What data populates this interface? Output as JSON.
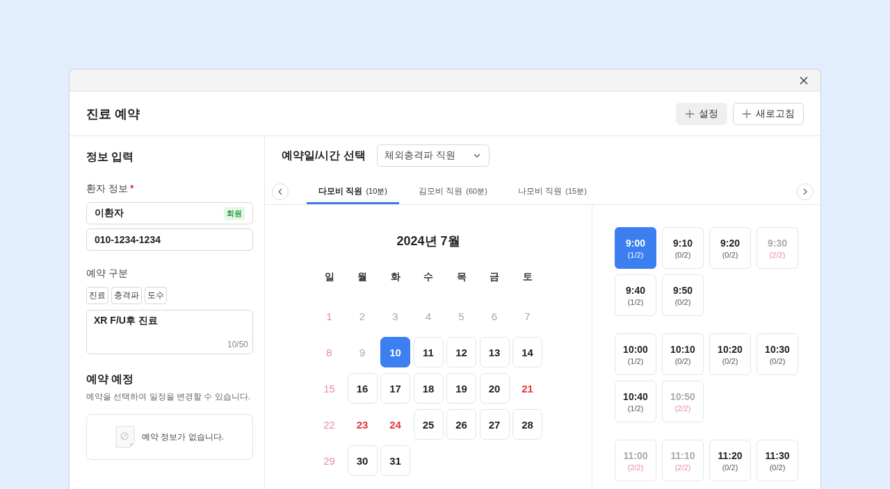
{
  "window": {
    "title": "진료 예약"
  },
  "header_buttons": [
    {
      "label": "설정",
      "kind": "filled"
    },
    {
      "label": "새로고침",
      "kind": "outline"
    }
  ],
  "info": {
    "title": "정보 입력",
    "patient_label": "환자 정보",
    "required_mark": "*",
    "patient_name": "이환자",
    "member_badge": "회원",
    "phone": "010-1234-1234",
    "type_label": "예약 구분",
    "type_tags": [
      "진료",
      "충격파",
      "도수"
    ],
    "memo": "XR F/U후 진료",
    "memo_count": "10/50"
  },
  "schedule": {
    "title": "예약 예정",
    "hint": "예약을 선택하여 일정을 변경할 수 있습니다.",
    "empty_text": "예약 정보가 없습니다."
  },
  "picker": {
    "title": "예약일/시간 선택",
    "dropdown_value": "체외충격파 직원"
  },
  "staff_tabs": [
    {
      "name": "다모비 직원",
      "duration": "(10분)",
      "selected": true
    },
    {
      "name": "김모비 직원",
      "duration": "(60분)",
      "selected": false
    },
    {
      "name": "나모비 직원",
      "duration": "(15분)",
      "selected": false
    }
  ],
  "calendar": {
    "month": "2024년 7월",
    "weekdays": [
      "일",
      "월",
      "화",
      "수",
      "목",
      "금",
      "토"
    ],
    "days": [
      {
        "day": "1",
        "kind": "sunday",
        "selected": false
      },
      {
        "day": "2",
        "kind": "past",
        "selected": false
      },
      {
        "day": "3",
        "kind": "past",
        "selected": false
      },
      {
        "day": "4",
        "kind": "past",
        "selected": false
      },
      {
        "day": "5",
        "kind": "past",
        "selected": false
      },
      {
        "day": "6",
        "kind": "past",
        "selected": false
      },
      {
        "day": "7",
        "kind": "past",
        "selected": false
      },
      {
        "day": "8",
        "kind": "sunday",
        "selected": false
      },
      {
        "day": "9",
        "kind": "past",
        "selected": false
      },
      {
        "day": "10",
        "kind": "open",
        "selected": true
      },
      {
        "day": "11",
        "kind": "open",
        "selected": false
      },
      {
        "day": "12",
        "kind": "open",
        "selected": false
      },
      {
        "day": "13",
        "kind": "open",
        "selected": false
      },
      {
        "day": "14",
        "kind": "open",
        "selected": false
      },
      {
        "day": "15",
        "kind": "sunday",
        "selected": false
      },
      {
        "day": "16",
        "kind": "open",
        "selected": false
      },
      {
        "day": "17",
        "kind": "open",
        "selected": false
      },
      {
        "day": "18",
        "kind": "open",
        "selected": false
      },
      {
        "day": "19",
        "kind": "open",
        "selected": false
      },
      {
        "day": "20",
        "kind": "open",
        "selected": false
      },
      {
        "day": "21",
        "kind": "holiday",
        "selected": false
      },
      {
        "day": "22",
        "kind": "sunday",
        "selected": false
      },
      {
        "day": "23",
        "kind": "holiday",
        "selected": false
      },
      {
        "day": "24",
        "kind": "holiday",
        "selected": false
      },
      {
        "day": "25",
        "kind": "open",
        "selected": false
      },
      {
        "day": "26",
        "kind": "open",
        "selected": false
      },
      {
        "day": "27",
        "kind": "open",
        "selected": false
      },
      {
        "day": "28",
        "kind": "open",
        "selected": false
      },
      {
        "day": "29",
        "kind": "sunday",
        "selected": false
      },
      {
        "day": "30",
        "kind": "open",
        "selected": false
      },
      {
        "day": "31",
        "kind": "open",
        "selected": false
      }
    ]
  },
  "time_groups": [
    {
      "slots": [
        {
          "time": "9:00",
          "count": "(1/2)",
          "full": false,
          "selected": true
        },
        {
          "time": "9:10",
          "count": "(0/2)",
          "full": false,
          "selected": false
        },
        {
          "time": "9:20",
          "count": "(0/2)",
          "full": false,
          "selected": false
        },
        {
          "time": "9:30",
          "count": "(2/2)",
          "full": true,
          "selected": false
        },
        {
          "time": "9:40",
          "count": "(1/2)",
          "full": false,
          "selected": false
        },
        {
          "time": "9:50",
          "count": "(0/2)",
          "full": false,
          "selected": false
        }
      ]
    },
    {
      "slots": [
        {
          "time": "10:00",
          "count": "(1/2)",
          "full": false,
          "selected": false
        },
        {
          "time": "10:10",
          "count": "(0/2)",
          "full": false,
          "selected": false
        },
        {
          "time": "10:20",
          "count": "(0/2)",
          "full": false,
          "selected": false
        },
        {
          "time": "10:30",
          "count": "(0/2)",
          "full": false,
          "selected": false
        },
        {
          "time": "10:40",
          "count": "(1/2)",
          "full": false,
          "selected": false
        },
        {
          "time": "10:50",
          "count": "(2/2)",
          "full": true,
          "selected": false
        }
      ]
    },
    {
      "slots": [
        {
          "time": "11:00",
          "count": "(2/2)",
          "full": true,
          "selected": false
        },
        {
          "time": "11:10",
          "count": "(2/2)",
          "full": true,
          "selected": false
        },
        {
          "time": "11:20",
          "count": "(0/2)",
          "full": false,
          "selected": false
        },
        {
          "time": "11:30",
          "count": "(0/2)",
          "full": false,
          "selected": false
        }
      ]
    }
  ]
}
